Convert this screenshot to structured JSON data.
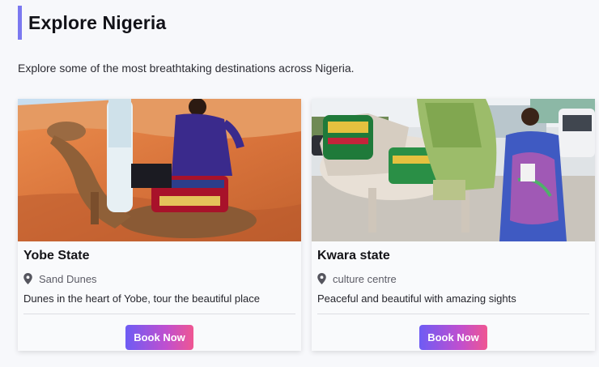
{
  "header": {
    "title": "Explore Nigeria",
    "description": "Explore some of the most breathtaking destinations across Nigeria.",
    "accent_color": "#7b78f0"
  },
  "cards": [
    {
      "title": "Yobe State",
      "location": "Sand Dunes",
      "location_icon": "map-pin-icon",
      "description": "Dunes in the heart of Yobe, tour the beautiful place",
      "button_label": "Book Now"
    },
    {
      "title": "Kwara state",
      "location": "culture centre",
      "location_icon": "map-pin-icon",
      "description": "Peaceful and beautiful with amazing sights",
      "button_label": "Book Now"
    }
  ],
  "button_gradient": [
    "#6e5cf4",
    "#ef5692"
  ]
}
